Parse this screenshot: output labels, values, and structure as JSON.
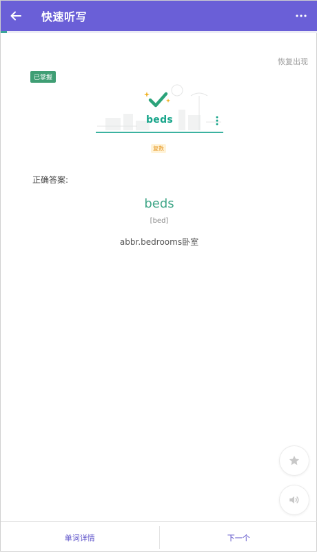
{
  "header": {
    "title": "快速听写",
    "back_icon": "arrow-left-icon",
    "more_icon": "more-horizontal-icon",
    "accent": "#6a5fd7"
  },
  "progress": {
    "fraction": 0.02,
    "color": "#3aa59a"
  },
  "status": {
    "restore_label": "恢复出现",
    "mastered_badge": "已掌握"
  },
  "word_card": {
    "word": "beds",
    "result_icon": "check-icon",
    "menu_icon": "kebab-menu-icon"
  },
  "tag": {
    "label": "复数"
  },
  "answer": {
    "label": "正确答案:",
    "word": "beds",
    "phonetic": "[bed]",
    "definition": "abbr.bedrooms卧室"
  },
  "fab": {
    "star_icon": "star-icon",
    "sound_icon": "speaker-icon"
  },
  "bottom_bar": {
    "details_label": "单词详情",
    "next_label": "下一个"
  }
}
